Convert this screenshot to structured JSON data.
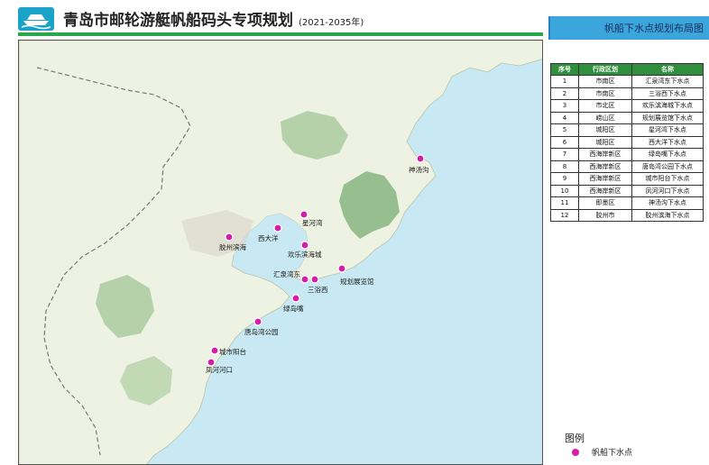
{
  "header": {
    "title": "青岛市邮轮游艇帆船码头专项规划",
    "years": "(2021-2035年)"
  },
  "panel": {
    "title": "帆船下水点规划布局图"
  },
  "table": {
    "headers": [
      "序号",
      "行政区划",
      "名称"
    ],
    "rows": [
      [
        "1",
        "市南区",
        "汇泉湾东下水点"
      ],
      [
        "2",
        "市南区",
        "三浴西下水点"
      ],
      [
        "3",
        "市北区",
        "欢乐滨海城下水点"
      ],
      [
        "4",
        "崂山区",
        "规划展览馆下水点"
      ],
      [
        "5",
        "城阳区",
        "星河湾下水点"
      ],
      [
        "6",
        "城阳区",
        "西大洋下水点"
      ],
      [
        "7",
        "西海岸新区",
        "绿岛嘴下水点"
      ],
      [
        "8",
        "西海岸新区",
        "唐岛湾公园下水点"
      ],
      [
        "9",
        "西海岸新区",
        "城市阳台下水点"
      ],
      [
        "10",
        "西海岸新区",
        "凤河河口下水点"
      ],
      [
        "11",
        "即墨区",
        "神汤沟下水点"
      ],
      [
        "12",
        "胶州市",
        "胶州滨海下水点"
      ]
    ]
  },
  "legend": {
    "title": "图例",
    "items": [
      {
        "label": "帆船下水点",
        "color": "#d61ca8"
      }
    ]
  },
  "map": {
    "points": [
      {
        "label": "神汤沟"
      },
      {
        "label": "星河湾"
      },
      {
        "label": "西大洋"
      },
      {
        "label": "胶州滨海"
      },
      {
        "label": "欢乐滨海城"
      },
      {
        "label": "汇泉湾东"
      },
      {
        "label": "三浴西"
      },
      {
        "label": "规划展览馆"
      },
      {
        "label": "绿岛嘴"
      },
      {
        "label": "唐岛湾公园"
      },
      {
        "label": "城市阳台"
      },
      {
        "label": "凤河河口"
      }
    ]
  },
  "colors": {
    "sea": "#c8e9f3",
    "land": "#eef2e2",
    "green": "#7fb27a",
    "marker": "#d61ca8",
    "header_bar": "#29a84a",
    "panel": "#3aa6dc"
  }
}
